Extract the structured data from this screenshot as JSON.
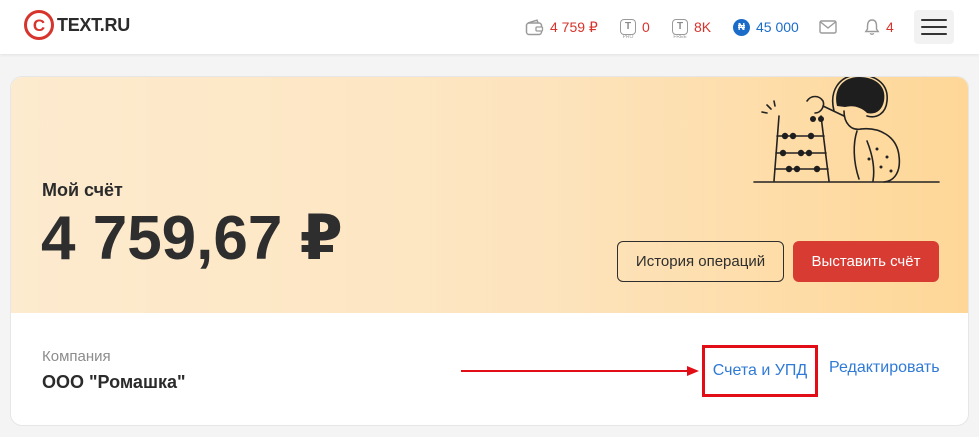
{
  "header": {
    "logo_text": "TEXT.RU",
    "balance": "4 759 ₽",
    "pro_count": "0",
    "free_count": "8K",
    "points": "45 000",
    "notifications": "4",
    "pro_sub": "PRO",
    "free_sub": "FREE",
    "n_symbol": "₦",
    "t_symbol": "T"
  },
  "account": {
    "title": "Мой счёт",
    "balance": "4 759,67 ₽",
    "history_button": "История операций",
    "invoice_button": "Выставить счёт"
  },
  "company": {
    "label": "Компания",
    "name": "ООО \"Ромашка\"",
    "invoices_link": "Счета и УПД",
    "edit_link": "Редактировать"
  },
  "colors": {
    "brand_red": "#d6342c",
    "link_blue": "#2f7ad6",
    "points_blue": "#1b6cc9",
    "highlight_red": "#e20e17"
  }
}
